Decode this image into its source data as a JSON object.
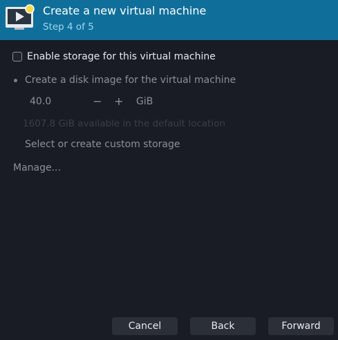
{
  "header": {
    "title": "Create a new virtual machine",
    "subtitle": "Step 4 of 5",
    "icon": "vm-play-icon",
    "color": "#0f6f9a"
  },
  "storage": {
    "enable_label": "Enable storage for this virtual machine",
    "enable_checked": false,
    "disk_image_label": "Create a disk image for the virtual machine",
    "disk_size_value": "40.0",
    "stepper_minus": "−",
    "stepper_plus": "+",
    "unit": "GiB",
    "available_text": "1607.8 GiB available in the default location",
    "custom_storage_label": "Select or create custom storage",
    "manage_label": "Manage..."
  },
  "buttons": {
    "cancel": "Cancel",
    "back": "Back",
    "forward": "Forward"
  }
}
